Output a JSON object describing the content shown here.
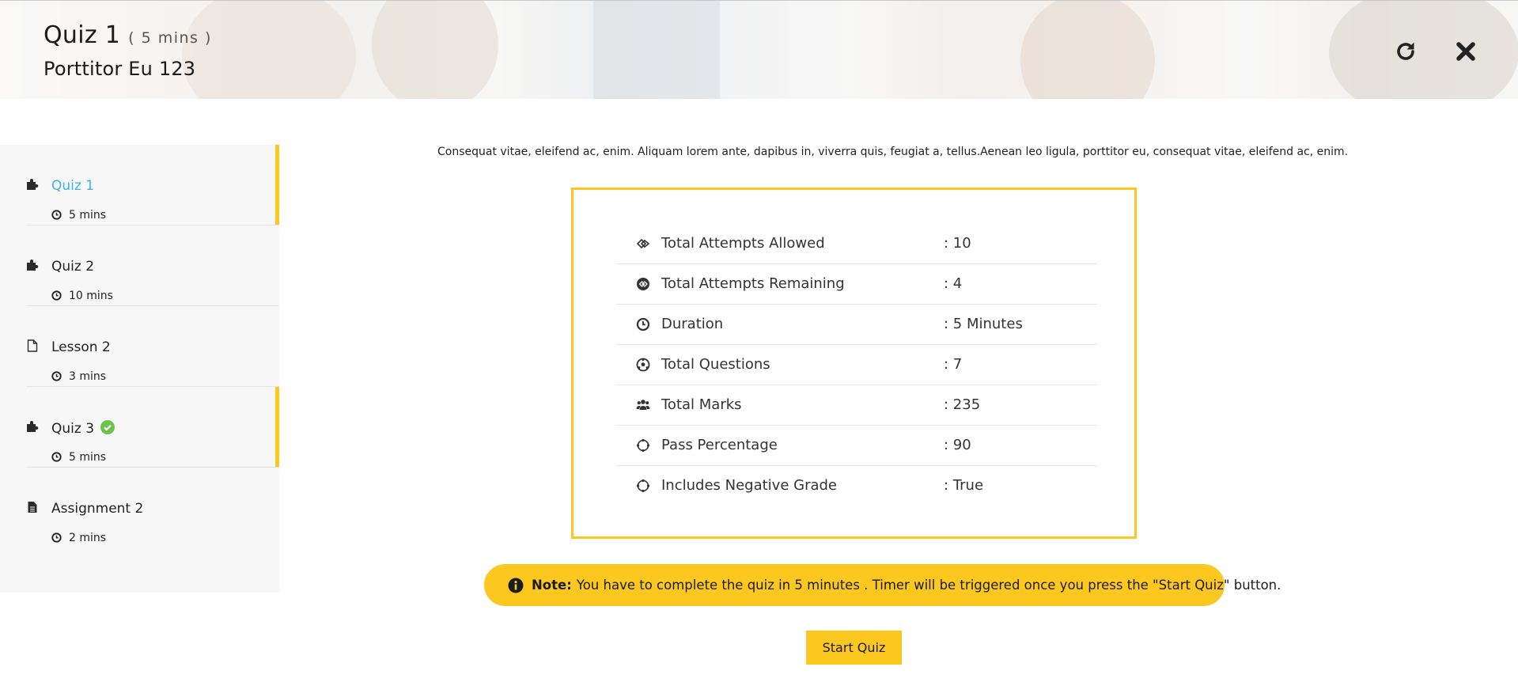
{
  "header": {
    "quiz_title": "Quiz 1",
    "quiz_duration": "( 5 mins )",
    "course_title": "Porttitor Eu 123",
    "refresh_icon": "refresh-icon",
    "close_icon": "close-icon"
  },
  "sidebar": {
    "items": [
      {
        "label": "Quiz 1",
        "time": "5 mins",
        "icon": "puzzle-icon",
        "state": "active"
      },
      {
        "label": "Quiz 2",
        "time": "10 mins",
        "icon": "puzzle-icon",
        "state": ""
      },
      {
        "label": "Lesson 2",
        "time": "3 mins",
        "icon": "file-outline-icon",
        "state": ""
      },
      {
        "label": "Quiz 3",
        "time": "5 mins",
        "icon": "puzzle-icon",
        "state": "completed"
      },
      {
        "label": "Assignment 2",
        "time": "2 mins",
        "icon": "file-text-icon",
        "state": ""
      }
    ]
  },
  "main": {
    "intro": "Consequat vitae, eleifend ac, enim. Aliquam lorem ante, dapibus in, viverra quis, feugiat a, tellus.Aenean leo ligula, porttitor eu, consequat vitae, eleifend ac, enim.",
    "info_rows": [
      {
        "icon": "attempts-allowed-icon",
        "label": "Total Attempts Allowed",
        "value": ": 10"
      },
      {
        "icon": "attempts-remaining-icon",
        "label": "Total Attempts Remaining",
        "value": ": 4"
      },
      {
        "icon": "clock-icon",
        "label": "Duration",
        "value": ": 5 Minutes"
      },
      {
        "icon": "soccer-ball-icon",
        "label": "Total Questions",
        "value": ": 7"
      },
      {
        "icon": "users-icon",
        "label": "Total Marks",
        "value": ": 235"
      },
      {
        "icon": "spinner-icon",
        "label": "Pass Percentage",
        "value": ": 90"
      },
      {
        "icon": "spinner-icon",
        "label": "Includes Negative Grade",
        "value": ": True"
      }
    ],
    "note": {
      "label": "Note:",
      "text": "You have to complete the quiz in 5 minutes . Timer will be triggered once you press the \"Start Quiz\" button."
    },
    "start_button": "Start Quiz"
  },
  "colors": {
    "accent": "#fcc820",
    "active_link": "#3fb3e9",
    "success": "#6cc24a"
  }
}
